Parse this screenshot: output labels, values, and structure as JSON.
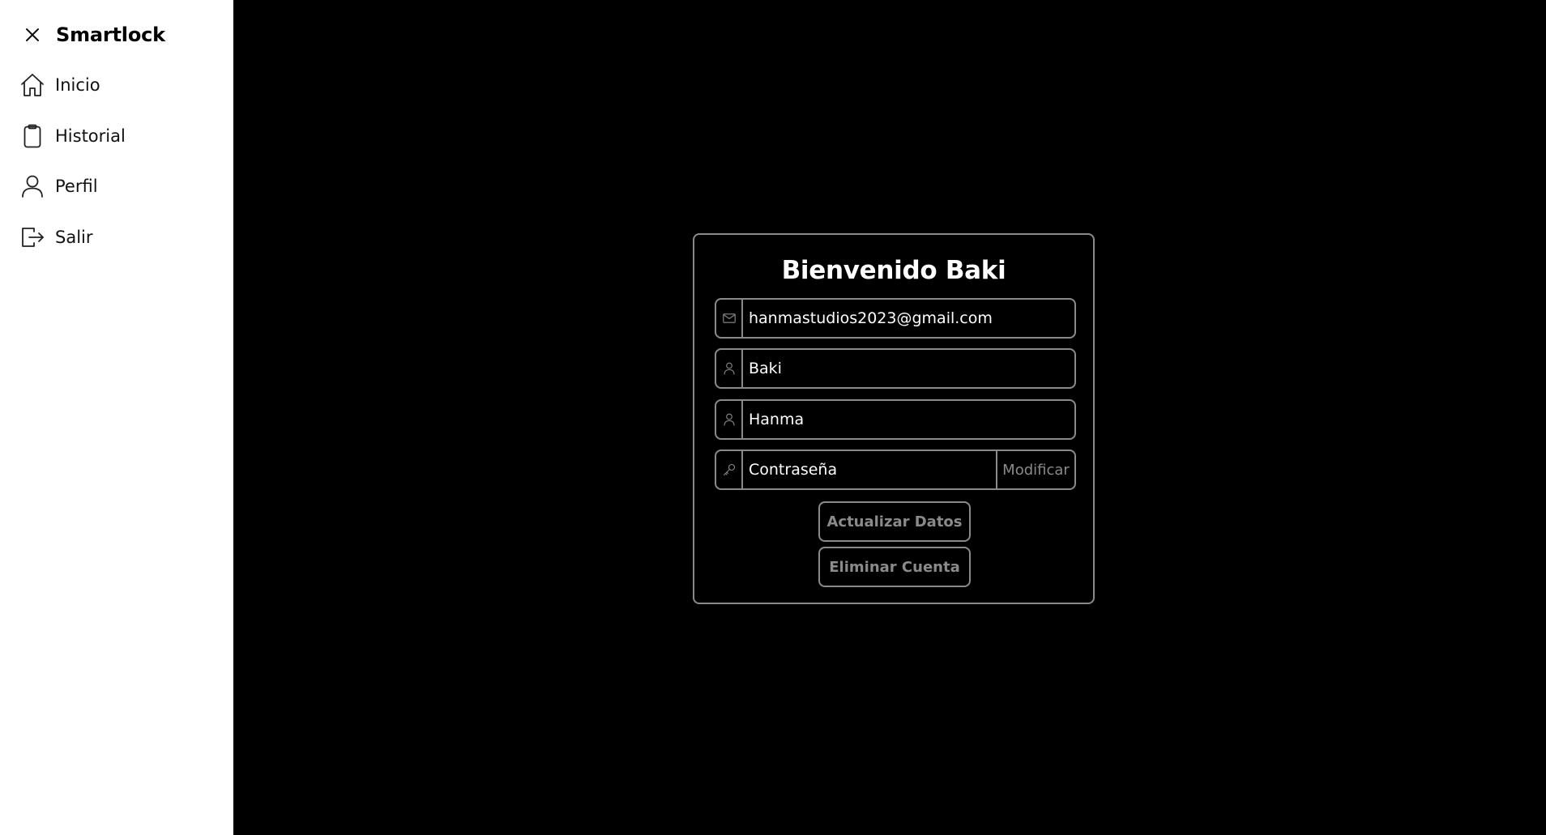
{
  "sidebar": {
    "brand": "Smartlock",
    "close_icon": "close-icon",
    "items": [
      {
        "label": "Inicio",
        "icon": "home-icon"
      },
      {
        "label": "Historial",
        "icon": "clipboard-icon"
      },
      {
        "label": "Perfil",
        "icon": "user-icon"
      },
      {
        "label": "Salir",
        "icon": "logout-icon"
      }
    ]
  },
  "profile": {
    "title": "Bienvenido Baki",
    "email": {
      "value": "hanmastudios2023@gmail.com",
      "icon": "mail-icon"
    },
    "first_name": {
      "value": "Baki",
      "icon": "user-icon"
    },
    "last_name": {
      "value": "Hanma",
      "icon": "user-icon"
    },
    "password": {
      "value": "Contraseña",
      "icon": "key-icon",
      "action_label": "Modificar"
    },
    "update_button": "Actualizar Datos",
    "delete_button": "Eliminar Cuenta"
  },
  "colors": {
    "background": "#000000",
    "sidebar": "#ffffff",
    "border": "#8a8a8a",
    "text_primary": "#ffffff",
    "text_muted": "#8a8a8a"
  }
}
